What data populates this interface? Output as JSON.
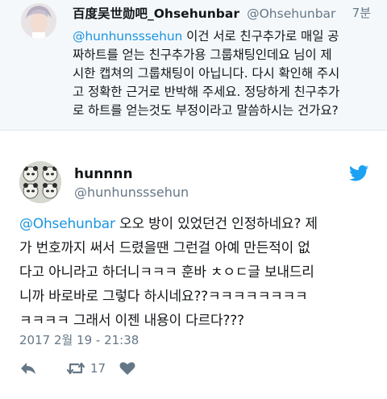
{
  "reply_tweet": {
    "display_name": "百度吴世勋吧_Ohsehunbar",
    "handle": "@Ohsehunbar",
    "time": "7분",
    "mention": "@hunhunsssehun",
    "text_line1_rest": " 이건 서로 친구추가로 매일 공",
    "text_lines": [
      "짜하트를 얻는 친구추가용 그룹채팅인데요 님이 제",
      "시한 캡쳐의 그룹채팅이 아닙니다. 다시 확인해 주시",
      "고 정확한 근거로 반박해 주세요. 정당하게 친구추가",
      "로 하트를 얻는것도 부정이라고 말씀하시는 건가요?"
    ]
  },
  "main_tweet": {
    "display_name": "hunnnn",
    "handle": "@hunhunsssehun",
    "mention": "@Ohsehunbar",
    "text_line1_rest": " 오오 방이 있었던건 인정하네요? 제",
    "text_lines": [
      "가 번호까지 써서 드렸을땐 그런걸 아예 만든적이 없",
      "다고 아니라고 하더니ㅋㅋㅋ 훈바 ㅊㅇㄷ글 보내드리",
      "니까 바로바로 그렇다 하시네요??ㅋㅋㅋㅋㅋㅋㅋㅋ",
      "ㅋㅋㅋㅋ 그래서 이젠 내용이 다르다???"
    ],
    "date": "2017 2월 19 - 21:38",
    "retweet_count": "17"
  },
  "colors": {
    "mention": "#1b95e0",
    "twitter_blue": "#1da1f2",
    "secondary_text": "#657786",
    "reply_background": "#f5f8fa"
  },
  "icons": [
    "reply-icon",
    "retweet-icon",
    "like-icon",
    "twitter-bird-icon"
  ]
}
